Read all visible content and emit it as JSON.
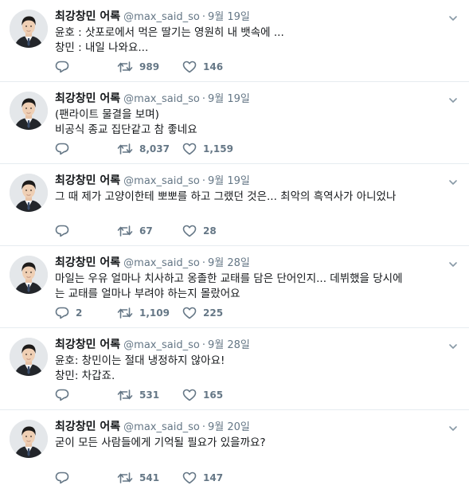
{
  "account": {
    "name": "최강창민 어록",
    "handle": "@max_said_so",
    "separator": "·"
  },
  "icons": {
    "reply": "reply-icon",
    "retweet": "retweet-icon",
    "like": "heart-icon",
    "more": "chevron-down-icon"
  },
  "tweets": [
    {
      "date": "9월 19일",
      "lines": [
        "윤호 : 삿포로에서 먹은 딸기는 영원히 내 뱃속에 ...",
        "창민 :  내일 나와요..."
      ],
      "replies": "",
      "retweets": "989",
      "likes": "146"
    },
    {
      "date": "9월 19일",
      "lines": [
        "(팬라이트 물결을 보며)",
        "비공식 종교 집단같고 참 좋네요"
      ],
      "replies": "",
      "retweets": "8,037",
      "likes": "1,159"
    },
    {
      "date": "9월 19일",
      "lines": [
        "그 때 제가 고양이한테 뽀뽀를 하고 그랬던 것은... 최악의 흑역사가 아니었나"
      ],
      "replies": "",
      "retweets": "67",
      "likes": "28"
    },
    {
      "date": "9월 28일",
      "lines": [
        "마일는 우유 얼마나 치사하고 옹졸한 교태를 담은 단어인지... 데뷔했을 당시에",
        "는 교태를 얼마나 부려야 하는지 몰랐어요"
      ],
      "replies": "2",
      "retweets": "1,109",
      "likes": "225"
    },
    {
      "date": "9월 28일",
      "lines": [
        "윤호: 창민이는 절대 냉정하지 않아요!",
        "창민: 차갑죠."
      ],
      "replies": "",
      "retweets": "531",
      "likes": "165"
    },
    {
      "date": "9월 20일",
      "lines": [
        "굳이 모든 사람들에게 기억될 필요가 있을까요?"
      ],
      "replies": "",
      "retweets": "541",
      "likes": "147"
    }
  ]
}
